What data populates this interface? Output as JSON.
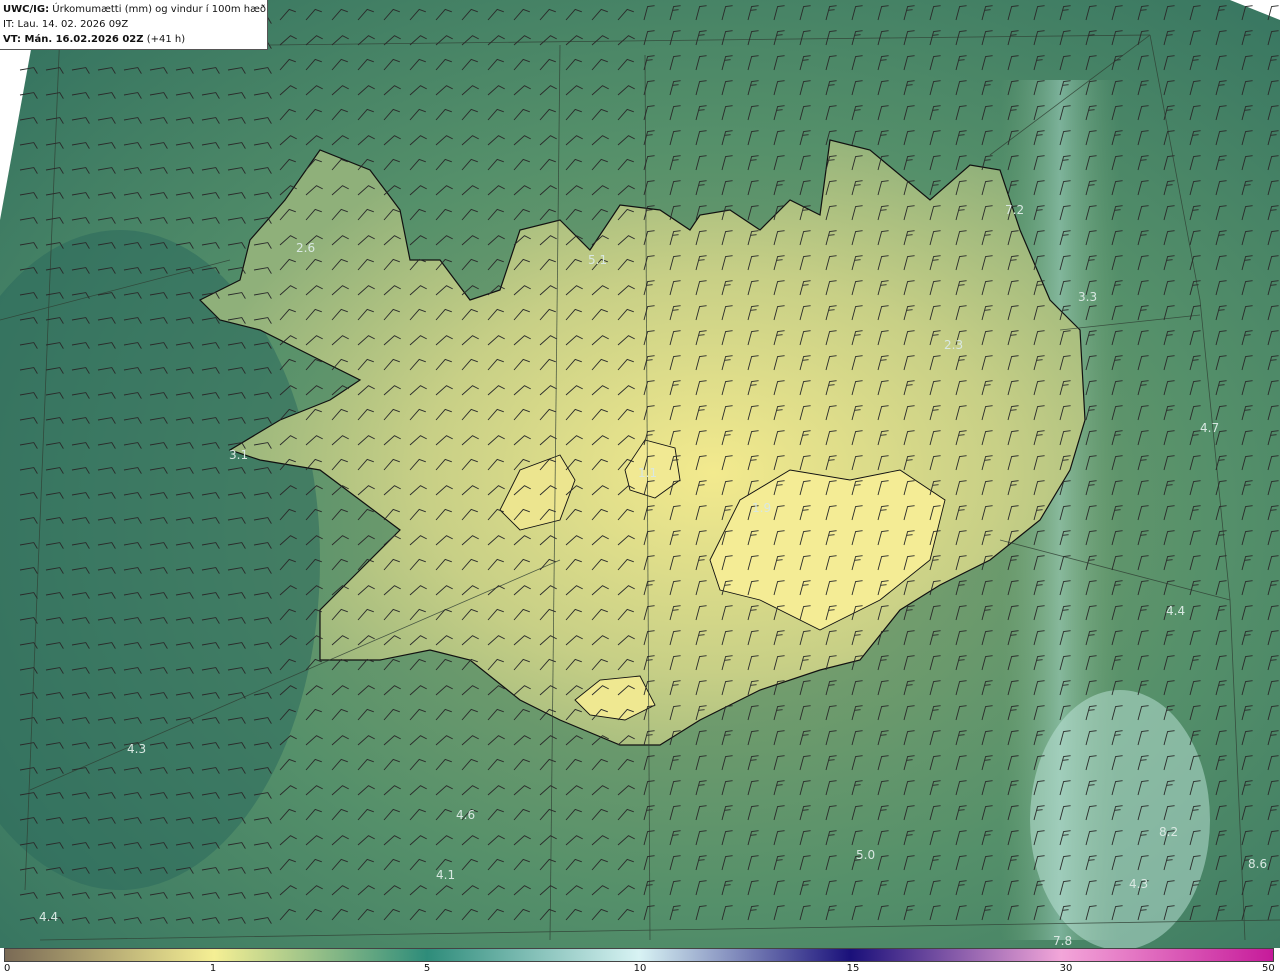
{
  "header": {
    "product": "UWC/IG:",
    "title": "Úrkomumætti (mm) og vindur í 100m hæð",
    "issue_time": "IT: Lau. 14. 02. 2026 09Z",
    "valid_prefix": "VT: Mán. 16.02.2026 02Z",
    "lead_time": "(+41 h)"
  },
  "colorbar": {
    "ticks": [
      "0",
      "1",
      "5",
      "10",
      "15",
      "30",
      "50"
    ],
    "stops": [
      {
        "value": "0",
        "color": "#7a6a55"
      },
      {
        "value": "1",
        "color": "#f5ef94"
      },
      {
        "value": "5",
        "color": "#2e8c7a"
      },
      {
        "value": "10",
        "color": "#d8f3f4"
      },
      {
        "value": "15",
        "color": "#1a107a"
      },
      {
        "value": "30",
        "color": "#f3a6d9"
      },
      {
        "value": "50",
        "color": "#c61a9a"
      }
    ]
  },
  "map_labels": [
    {
      "text": "5.1"
    },
    {
      "text": "7.2"
    },
    {
      "text": "3.3"
    },
    {
      "text": "2.3"
    },
    {
      "text": "2.6"
    },
    {
      "text": "3.1"
    },
    {
      "text": "4.7"
    },
    {
      "text": "4.4"
    },
    {
      "text": "4.3"
    },
    {
      "text": "4.6"
    },
    {
      "text": "4.1"
    },
    {
      "text": "4.4"
    },
    {
      "text": "5.0"
    },
    {
      "text": "8.2"
    },
    {
      "text": "4.3"
    },
    {
      "text": "8.6"
    },
    {
      "text": "7.8"
    },
    {
      "text": "1.9"
    },
    {
      "text": "1.1"
    }
  ],
  "colors": {
    "ocean_dark": "#2f6e5e",
    "ocean_mid": "#4e8a68",
    "land_light": "#d8d98a",
    "land_peak": "#f3ea8e",
    "coastline": "#111111",
    "gridline": "#3a4a3a"
  }
}
